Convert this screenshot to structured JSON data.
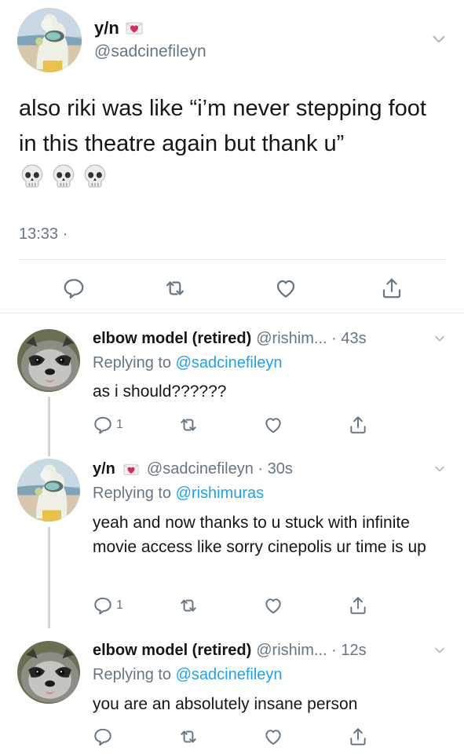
{
  "main": {
    "display_name": "y/n",
    "handle": "@sadcinefileyn",
    "text": "also riki was like “i’m never stepping foot in this theatre again but thank u”",
    "emoji": "skull-emoji x3",
    "time": "13:33 ·"
  },
  "replies": [
    {
      "display_name": "elbow model (retired)",
      "meta": "@rishim... · 43s",
      "replying_label": "Replying to",
      "replying_to": "@sadcinefileyn",
      "text": "as i should??????",
      "reply_count": "1"
    },
    {
      "display_name": "y/n",
      "meta": "@sadcinefileyn · 30s",
      "replying_label": "Replying to",
      "replying_to": "@rishimuras",
      "text": "yeah and now thanks to u stuck with infinite movie access like sorry cinepolis ur time is up",
      "reply_count": "1"
    },
    {
      "display_name": "elbow model (retired)",
      "meta": "@rishim... · 12s",
      "replying_label": "Replying to",
      "replying_to": "@sadcinefileyn",
      "text": "you are an absolutely insane person",
      "reply_count": ""
    }
  ],
  "colors": {
    "text": "#14171a",
    "muted": "#657786",
    "link": "#1da1f2",
    "divider": "#e1e8ed",
    "heart": "#e0245e"
  }
}
